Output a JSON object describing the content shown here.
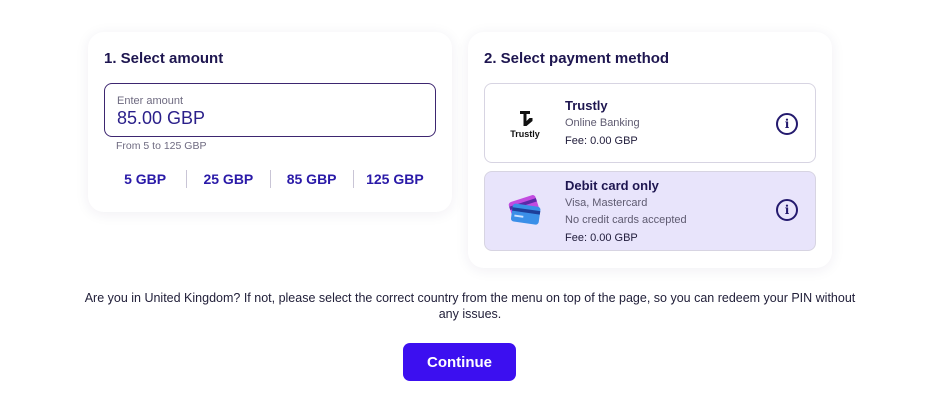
{
  "amount_section": {
    "title": "1. Select amount",
    "field_label": "Enter amount",
    "field_value": "85.00 GBP",
    "hint": "From 5 to 125 GBP",
    "presets": [
      "5 GBP",
      "25 GBP",
      "85 GBP",
      "125 GBP"
    ]
  },
  "payment_section": {
    "title": "2. Select payment method",
    "methods": [
      {
        "name": "Trustly",
        "logo_text": "Trustly",
        "lines": [
          "Online Banking"
        ],
        "fee": "Fee: 0.00 GBP",
        "selected": false,
        "icon": "trustly-logo"
      },
      {
        "name": "Debit card only",
        "lines": [
          "Visa, Mastercard",
          "No credit cards accepted"
        ],
        "fee": "Fee: 0.00 GBP",
        "selected": true,
        "icon": "debit-card-icon"
      }
    ]
  },
  "notice": "Are you in United Kingdom? If not, please select the correct country from the menu on top of the page, so you can redeem your PIN without any issues.",
  "continue_label": "Continue",
  "colors": {
    "accent": "#3c0ff0",
    "title": "#1e1650",
    "selected_bg": "#e8e4fb",
    "preset_text": "#2a1aa8"
  }
}
